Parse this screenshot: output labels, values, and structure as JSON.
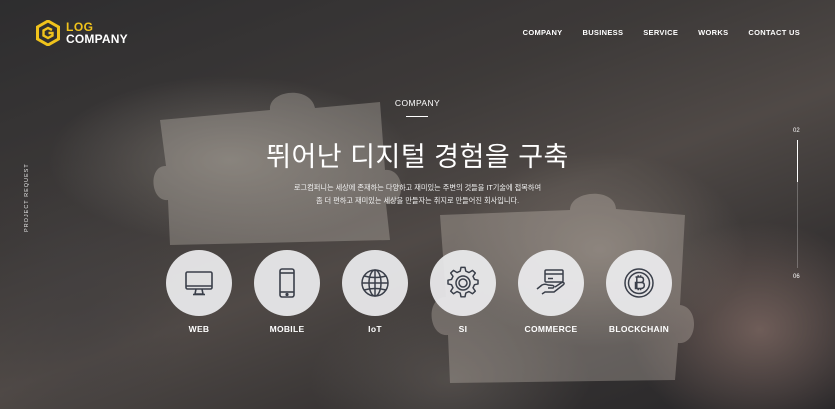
{
  "header": {
    "logo": {
      "line1": "LOG",
      "line2": "COMPANY"
    },
    "nav": [
      {
        "label": "COMPANY"
      },
      {
        "label": "BUSINESS"
      },
      {
        "label": "SERVICE"
      },
      {
        "label": "WORKS"
      },
      {
        "label": "CONTACT US"
      }
    ]
  },
  "side_label": "PROJECT REQUEST",
  "pager": {
    "current": "02",
    "total": "06",
    "progress": 0.33
  },
  "hero": {
    "eyebrow": "COMPANY",
    "headline": "뛰어난 디지털 경험을 구축",
    "desc_line1": "로그컴퍼니는 세상에 존재하는 다양하고 재미있는 주변의 것들을 IT기술에 접목하여",
    "desc_line2": "좀 더 편하고 재미있는 세상을 만들자는 취지로 만들어진 회사입니다."
  },
  "services": [
    {
      "label": "WEB",
      "icon": "monitor-icon"
    },
    {
      "label": "MOBILE",
      "icon": "smartphone-icon"
    },
    {
      "label": "IoT",
      "icon": "globe-icon"
    },
    {
      "label": "SI",
      "icon": "gear-icon"
    },
    {
      "label": "COMMERCE",
      "icon": "card-payment-icon"
    },
    {
      "label": "BLOCKCHAIN",
      "icon": "bitcoin-icon"
    }
  ],
  "colors": {
    "accent": "#f0c31c",
    "icon_stroke": "#3a3f4a",
    "circle_bg": "#ececee"
  }
}
